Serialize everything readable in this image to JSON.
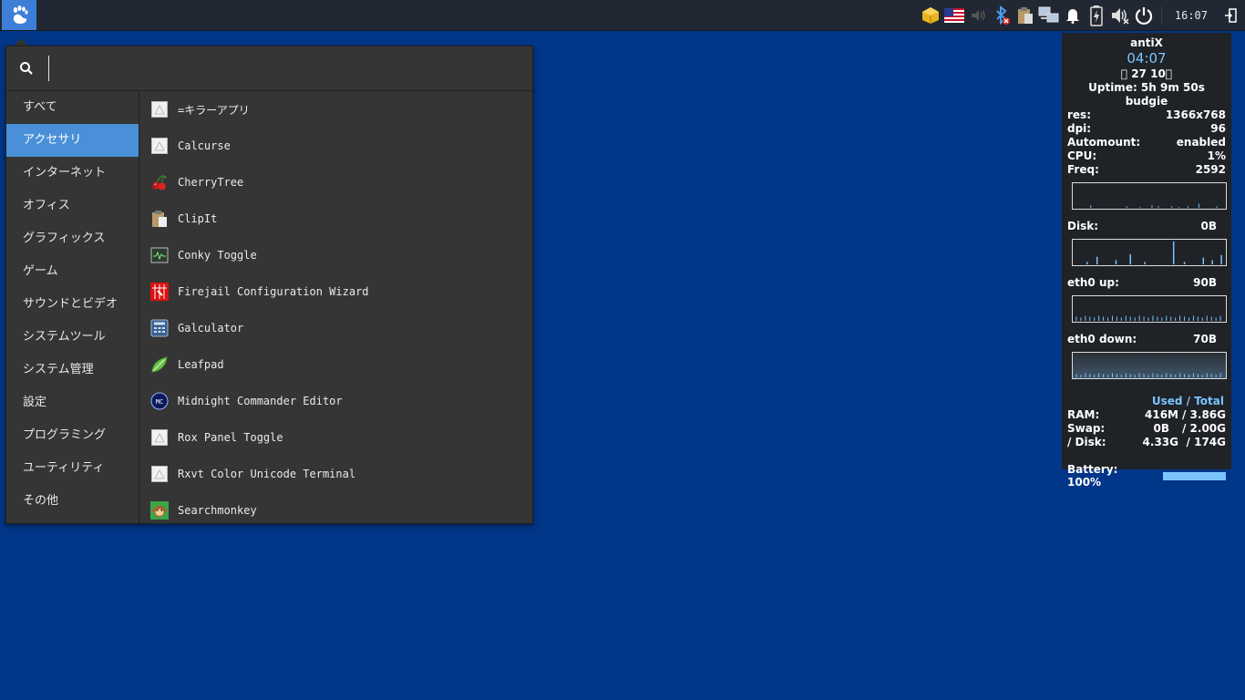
{
  "panel": {
    "clock": "16:07",
    "tray_icons": [
      "package-updates-icon",
      "us-flag-icon",
      "volume-icon",
      "bluetooth-icon",
      "clipboard-icon",
      "network-icon",
      "notification-bell-icon",
      "battery-charging-icon",
      "volume-muted-icon",
      "power-icon",
      "logout-icon"
    ]
  },
  "menu": {
    "search_placeholder": "",
    "categories": [
      {
        "label": "すべて"
      },
      {
        "label": "アクセサリ"
      },
      {
        "label": "インターネット"
      },
      {
        "label": "オフィス"
      },
      {
        "label": "グラフィックス"
      },
      {
        "label": "ゲーム"
      },
      {
        "label": "サウンドとビデオ"
      },
      {
        "label": "システムツール"
      },
      {
        "label": "システム管理"
      },
      {
        "label": "設定"
      },
      {
        "label": "プログラミング"
      },
      {
        "label": "ユーティリティ"
      },
      {
        "label": "その他"
      }
    ],
    "active_category": "アクセサリ",
    "apps": [
      {
        "label": "=キラーアプリ",
        "icon": "placeholder-icon"
      },
      {
        "label": "Calcurse",
        "icon": "placeholder-icon"
      },
      {
        "label": "CherryTree",
        "icon": "cherry-icon"
      },
      {
        "label": "ClipIt",
        "icon": "clipboard-icon"
      },
      {
        "label": "Conky Toggle",
        "icon": "monitor-icon"
      },
      {
        "label": "Firejail Configuration Wizard",
        "icon": "firejail-icon"
      },
      {
        "label": "Galculator",
        "icon": "calculator-icon"
      },
      {
        "label": "Leafpad",
        "icon": "leaf-icon"
      },
      {
        "label": "Midnight Commander Editor",
        "icon": "mc-icon"
      },
      {
        "label": "Rox Panel Toggle",
        "icon": "placeholder-icon"
      },
      {
        "label": "Rxvt Color Unicode Terminal",
        "icon": "placeholder-icon"
      },
      {
        "label": "Searchmonkey",
        "icon": "monkey-icon"
      }
    ]
  },
  "conky": {
    "host": "antiX",
    "time": "04:07",
    "date": "\u0000 27 10\u0000",
    "uptime": "Uptime: 5h 9m 50s",
    "user": "budgie",
    "stats": [
      {
        "label": "res:",
        "value": "1366x768"
      },
      {
        "label": "dpi:",
        "value": "96"
      },
      {
        "label": "Automount:",
        "value": "enabled"
      },
      {
        "label": "CPU:",
        "value": "1%"
      },
      {
        "label": "Freq:",
        "value": "2592"
      }
    ],
    "disk": {
      "label": "Disk:",
      "value": "0B"
    },
    "eth_up": {
      "label": "eth0 up:",
      "value": "90B"
    },
    "eth_down": {
      "label": "eth0 down:",
      "value": "70B"
    },
    "used_total": "Used / Total",
    "mem": [
      {
        "label": "RAM:",
        "used": "416M",
        "total": "/ 3.86G"
      },
      {
        "label": "Swap:",
        "used": "0B",
        "total": "/ 2.00G"
      },
      {
        "label": "/ Disk:",
        "used": "4.33G",
        "total": "/ 174G"
      }
    ],
    "battery": {
      "label": "Battery: 100%",
      "level": 1.0
    },
    "colors": {
      "accent": "#7cc4ff",
      "panel_bg": "#1f2226"
    }
  }
}
